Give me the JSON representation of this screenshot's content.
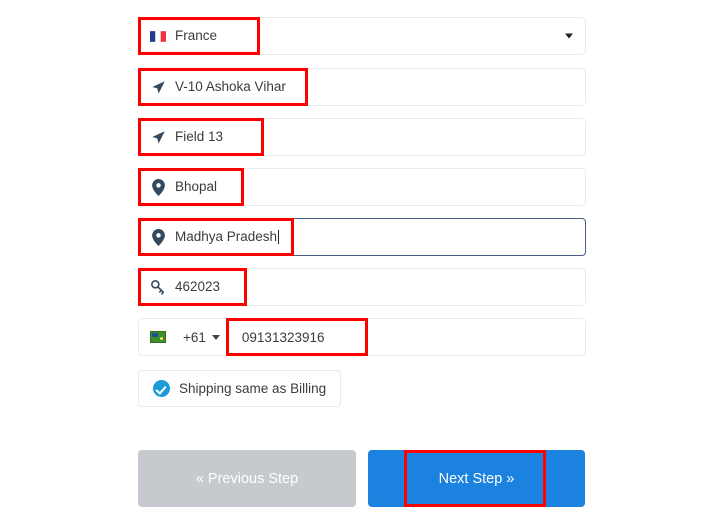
{
  "form": {
    "fields": [
      {
        "name": "country-select",
        "icon": "flag-france-icon",
        "value": "France",
        "type": "select",
        "focused": false
      },
      {
        "name": "address-line-1-input",
        "icon": "navigation-arrow-icon",
        "value": "V-10 Ashoka Vihar",
        "type": "text",
        "focused": false
      },
      {
        "name": "address-line-2-input",
        "icon": "navigation-arrow-icon",
        "value": "Field 13",
        "type": "text",
        "focused": false
      },
      {
        "name": "city-input",
        "icon": "map-pin-icon",
        "value": "Bhopal",
        "type": "text",
        "focused": false
      },
      {
        "name": "state-input",
        "icon": "map-pin-icon",
        "value": "Madhya Pradesh",
        "type": "text",
        "focused": true
      },
      {
        "name": "zip-code-input",
        "icon": "key-icon",
        "value": "462023",
        "type": "text",
        "focused": false
      }
    ],
    "phone": {
      "flag_icon": "flag-australia-icon",
      "country_code": "+61",
      "number": "09131323916"
    },
    "shipping_same_as_billing": {
      "label": "Shipping same as Billing",
      "checked": true,
      "icon": "check-circle-icon"
    },
    "buttons": {
      "previous": "« Previous Step",
      "next": "Next Step »"
    }
  },
  "colors": {
    "accent_blue": "#1b82df",
    "disabled_gray": "#c6c9ce",
    "annotation_red": "#fe0000",
    "focus_border": "#4a5d87",
    "icon_navy": "#34495e",
    "check_blue": "#1e9ad6"
  }
}
